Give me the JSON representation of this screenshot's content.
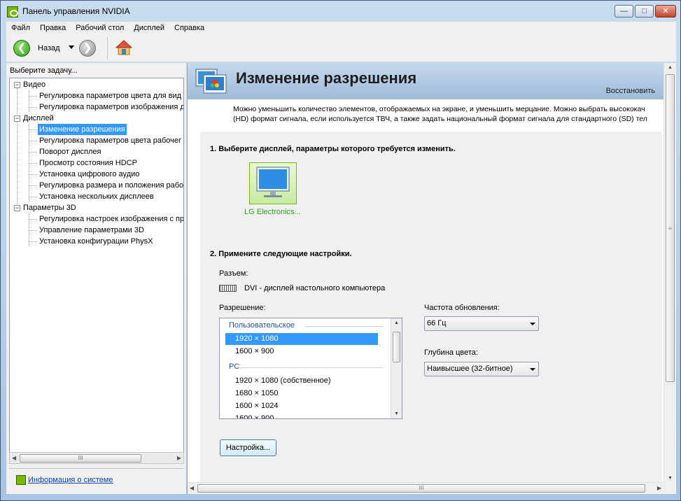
{
  "window": {
    "title": "Панель управления NVIDIA",
    "controls": {
      "minimize": "—",
      "maximize": "□",
      "close": "✕"
    }
  },
  "menu": [
    "Файл",
    "Правка",
    "Рабочий стол",
    "Дисплей",
    "Справка"
  ],
  "toolbar": {
    "back_label": "Назад"
  },
  "left": {
    "header": "Выберите задачу...",
    "tree": [
      {
        "label": "Видео",
        "children": [
          "Регулировка параметров цвета для вид",
          "Регулировка параметров изображения д"
        ]
      },
      {
        "label": "Дисплей",
        "children": [
          "Изменение разрешения",
          "Регулировка параметров цвета рабочег",
          "Поворот дисплея",
          "Просмотр состояния HDCP",
          "Установка цифрового аудио",
          "Регулировка размера и положения рабо",
          "Установка нескольких дисплеев"
        ]
      },
      {
        "label": "Параметры 3D",
        "children": [
          "Регулировка настроек изображения с пр",
          "Управление параметрами 3D",
          "Установка конфигурации PhysX"
        ]
      }
    ],
    "selected": "Изменение разрешения",
    "scroll_thumb": "III",
    "footer_link": "Информация о системе"
  },
  "page": {
    "title": "Изменение разрешения",
    "restore": "Восстановить",
    "description_line1": "Можно уменьшить количество элементов, отображаемых на экране, и уменьшить мерцание. Можно выбрать высококач",
    "description_line2": "(HD) формат сигнала, если используется ТВЧ, а также задать национальный формат сигнала для стандартного (SD) тел",
    "step1": "1. Выберите дисплей, параметры которого требуется изменить.",
    "display_name": "LG Electronics...",
    "step2": "2. Примените следующие настройки.",
    "connector_label": "Разъем:",
    "connector_value": "DVI - дисплей настольного компьютера",
    "resolution_label": "Разрешение:",
    "resolution_groups": [
      {
        "header": "Пользовательское",
        "items": [
          "1920 × 1080",
          "1600 × 900"
        ]
      },
      {
        "header": "PC",
        "items": [
          "1920 × 1080 (собственное)",
          "1680 × 1050",
          "1600 × 1024",
          "1600 × 900"
        ]
      }
    ],
    "selected_resolution": "1920 × 1080",
    "refresh_label": "Частота обновления:",
    "refresh_value": "66 Гц",
    "depth_label": "Глубина цвета:",
    "depth_value": "Наивысшее (32-битное)",
    "customize_button": "Настройка...",
    "scroll_thumb": "III"
  }
}
